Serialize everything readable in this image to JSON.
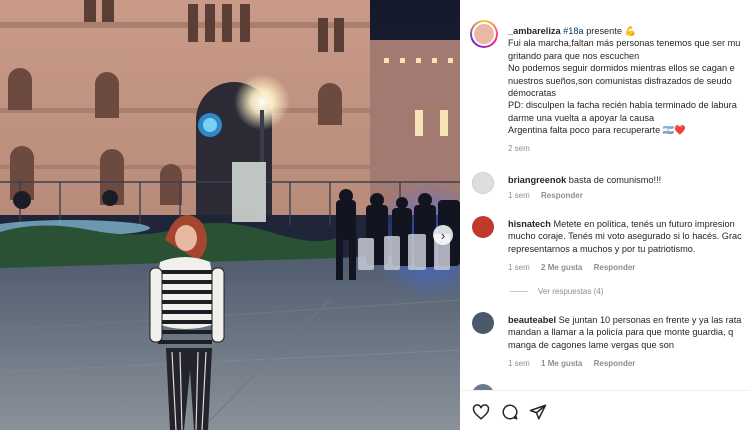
{
  "post": {
    "author": "_ambareliza",
    "hashtag": "#18a",
    "caption_suffix": "presente 💪",
    "caption_lines": [
      "Fui ala marcha,faltan más personas tenemos que ser mu",
      "gritando para que nos escuchen",
      "No podemos seguir dormidos mientras ellos se cagan e",
      "nuestros sueños,son comunistas disfrazados de seudo",
      "démocratas",
      "PD: disculpen la facha recién había terminado de labura",
      "darme una vuelta a apoyar la causa",
      "Argentina falta poco para recuperarte 🇦🇷❤️"
    ],
    "time": "2 sem"
  },
  "comments": [
    {
      "username": "briangreenok",
      "lines": [
        "basta de comunismo!!!"
      ],
      "time": "1 sem",
      "likes": "",
      "reply": "Responder",
      "avatar_color": "#dcdcdc"
    },
    {
      "username": "hisnatech",
      "lines": [
        "Metete en política, tenés un futuro impresion",
        "mucho coraje. Tenés mi voto asegurado si lo hacés. Grac",
        "representarnos a muchos y por tu patriotismo."
      ],
      "time": "1 sem",
      "likes": "2 Me gusta",
      "reply": "Responder",
      "avatar_color": "#c0392b"
    },
    {
      "username": "beauteabel",
      "lines": [
        "Se juntan 10 personas en frente y ya las rata",
        "mandan a llamar a la policía para que monte guardia, q",
        "manga de cagones lame vergas que son"
      ],
      "time": "1 sem",
      "likes": "1 Me gusta",
      "reply": "Responder",
      "avatar_color": "#4a5a6a"
    }
  ],
  "view_replies": "Ver respuestas (4)",
  "icons": {
    "like": "heart-icon",
    "comment": "comment-icon",
    "share": "send-icon",
    "carousel": "chevron-right-icon"
  },
  "colors": {
    "hashtag": "#00376b",
    "muted": "#8e8e8e",
    "text": "#262626"
  }
}
